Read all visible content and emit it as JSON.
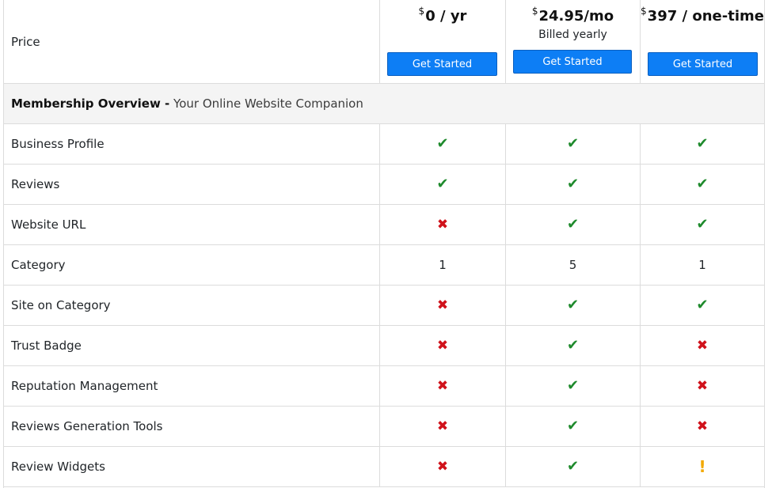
{
  "header": {
    "price_label": "Price",
    "plans": [
      {
        "currency": "$",
        "price": "0 / yr",
        "billing": "",
        "cta_label": "Get Started"
      },
      {
        "currency": "$",
        "price": "24.95/mo",
        "billing": "Billed yearly",
        "cta_label": "Get Started"
      },
      {
        "currency": "$",
        "price": "397 / one-time",
        "billing": "",
        "cta_label": "Get Started"
      }
    ]
  },
  "section": {
    "title": "Membership Overview -",
    "subtitle": "Your Online Website Companion"
  },
  "features": [
    {
      "name": "Business Profile",
      "values": [
        "check",
        "check",
        "check"
      ]
    },
    {
      "name": "Reviews",
      "values": [
        "check",
        "check",
        "check"
      ]
    },
    {
      "name": "Website URL",
      "values": [
        "cross",
        "check",
        "check"
      ]
    },
    {
      "name": "Category",
      "values": [
        "1",
        "5",
        "1"
      ]
    },
    {
      "name": "Site on Category",
      "values": [
        "cross",
        "check",
        "check"
      ]
    },
    {
      "name": "Trust Badge",
      "values": [
        "cross",
        "check",
        "cross"
      ]
    },
    {
      "name": "Reputation Management",
      "values": [
        "cross",
        "check",
        "cross"
      ]
    },
    {
      "name": "Reviews Generation Tools",
      "values": [
        "cross",
        "check",
        "cross"
      ]
    },
    {
      "name": "Review Widgets",
      "values": [
        "cross",
        "check",
        "warning"
      ]
    }
  ],
  "icons": {
    "check": "check-icon",
    "cross": "cross-icon",
    "warning": "warning-icon"
  },
  "colors": {
    "button": "#0d7ef5",
    "check": "#1e8a2c",
    "cross": "#d0121b",
    "warning": "#f2a900"
  }
}
